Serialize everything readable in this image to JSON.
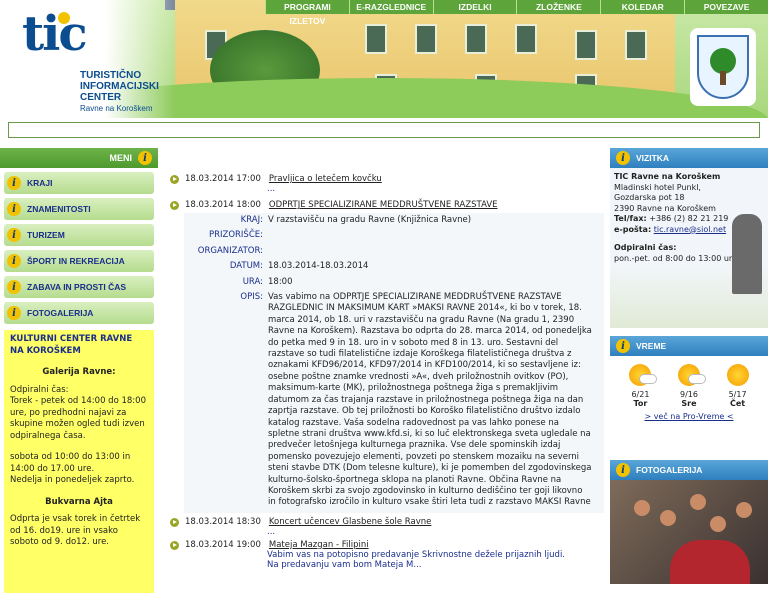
{
  "header": {
    "logo_big": "tic",
    "logo_lines": [
      "TURISTIČNO",
      "INFORMACIJSKI",
      "CENTER"
    ],
    "logo_sub": "Ravne na Koroškem"
  },
  "topnav": [
    "PROGRAMI IZLETOV",
    "E-RAZGLEDNICE",
    "IZDELKI",
    "ZLOŽENKE",
    "KOLEDAR",
    "POVEZAVE"
  ],
  "left": {
    "menu_title": "MENI",
    "menu": [
      "KRAJI",
      "ZNAMENITOSTI",
      "TURIZEM",
      "ŠPORT IN REKREACIJA",
      "ZABAVA IN PROSTI ČAS",
      "FOTOGALERIJA"
    ],
    "kc_title": "KULTURNI CENTER RAVNE NA KOROŠKEM",
    "galerija_title": "Galerija Ravne:",
    "galerija_p1": "Odpiralni čas:\nTorek - petek od 14:00 do 18:00 ure, po predhodni najavi za skupine možen ogled tudi izven odpiralnega časa.",
    "galerija_p2": "sobota od 10:00 do 13:00 in 14:00 do 17.00 ure.\nNedelja in ponedeljek zaprto.",
    "bukvarna_title": "Bukvarna Ajta",
    "bukvarna_p": "Odprta je vsak torek in četrtek od 16. do19. ure in vsako soboto od 9. do12. ure."
  },
  "events": [
    {
      "date": "18.03.2014 17:00",
      "title": "Pravljica o letečem kovčku",
      "sub": "..."
    },
    {
      "date": "18.03.2014 18:00",
      "title": "ODPRTJE SPECIALIZIRANE MEDDRUŠTVENE RAZSTAVE"
    }
  ],
  "detail": {
    "kraj_label": "KRAJ:",
    "kraj": "V razstavišču na gradu Ravne (Knjižnica Ravne)",
    "prizorisce_label": "PRIZORIŠČE:",
    "prizorisce": "",
    "organizator_label": "ORGANIZATOR:",
    "organizator": "",
    "datum_label": "DATUM:",
    "datum": "18.03.2014-18.03.2014",
    "ura_label": "URA:",
    "ura": "18:00",
    "opis_label": "OPIS:",
    "opis": "Vas vabimo na ODPRTJE SPECIALIZIRANE MEDDRUŠTVENE RAZSTAVE RAZGLEDNIC IN MAKSIMUM KART »MAKSI RAVNE 2014«, ki bo v torek, 18. marca 2014, ob 18. uri v razstavišču na gradu Ravne (Na gradu 1, 2390 Ravne na Koroškem). Razstava bo odprta do 28. marca 2014, od ponedeljka do petka med 9 in 18. uro in v soboto med 8 in 13. uro. Sestavni del razstave so tudi filatelistične izdaje Koroškega filatelističnega društva z oznakami KFD96/2014, KFD97/2014 in KFD100/2014, ki so sestavljene iz: osebne poštne znamke vrednosti »A«, dveh priložnostnih ovitkov (PO), maksimum-karte (MK), priložnostnega poštnega žiga s premakljivim datumom za čas trajanja razstave in priložnostnega poštnega žiga na dan zaprtja razstave. Ob tej priložnosti bo Koroško filatelistično društvo izdalo katalog razstave. Vaša sodelna radovednost pa vas lahko ponese na spletne strani društva www.kfd.si, ki so luč elektronskega sveta ugledale na predvečer letošnjega kulturnega praznika. Vse dele spominskih izdaj pomensko povezujejo elementi, povzeti po stenskem mozaiku na severni steni stavbe DTK (Dom telesne kulture), ki je pomemben del zgodovinskega kulturno-šolsko-športnega sklopa na planoti Ravne. Občina Ravne na Koroškem skrbi za svojo zgodovinsko in kulturno dediščino ter goji likovno in fotografsko izročilo in kulturo vsake štiri leta tudi z razstavo MAKSI Ravne"
  },
  "events2": [
    {
      "date": "18.03.2014 18:30",
      "title": "Koncert učencev Glasbene šole Ravne",
      "sub": "..."
    },
    {
      "date": "18.03.2014 19:00",
      "title": "Mateja Mazgan - Filipini",
      "sub": "Vabim vas na potopisno predavanje Skrivnostne dežele prijaznih ljudi. Na predavanju vam bom Mateja M..."
    }
  ],
  "right": {
    "vizitka_title": "VIZITKA",
    "v_name": "TIC Ravne na Koroškem",
    "v_addr1": "Mladinski hotel Punkl,",
    "v_addr2": "Gozdarska pot 18",
    "v_addr3": "2390 Ravne na Koroškem",
    "v_tel_label": "Tel/fax:",
    "v_tel": "+386 (2) 82 21 219",
    "v_mail_label": "e-pošta:",
    "v_mail": "tic.ravne@siol.net",
    "v_hours_label": "Odpiralni čas:",
    "v_hours": "pon.-pet. od 8:00 do 13:00 ure",
    "vreme_title": "VREME",
    "weather": [
      {
        "temp": "6/21",
        "day": "Tor"
      },
      {
        "temp": "9/16",
        "day": "Sre"
      },
      {
        "temp": "5/17",
        "day": "Čet"
      }
    ],
    "vreme_link": "> več na Pro-Vreme <",
    "foto_title": "FOTOGALERIJA"
  }
}
